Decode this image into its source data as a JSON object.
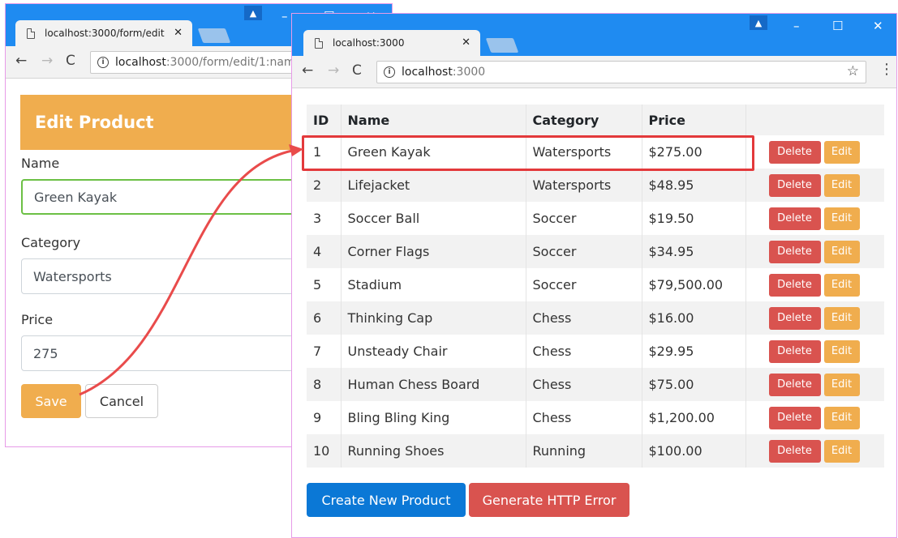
{
  "back_window": {
    "tab_title": "localhost:3000/form/edit",
    "url_host": "localhost",
    "url_path": ":3000/form/edit/1:nam",
    "panel_title": "Edit Product",
    "fields": [
      {
        "label": "Name",
        "value": "Green Kayak"
      },
      {
        "label": "Category",
        "value": "Watersports"
      },
      {
        "label": "Price",
        "value": "275"
      }
    ],
    "save_label": "Save",
    "cancel_label": "Cancel"
  },
  "front_window": {
    "tab_title": "localhost:3000",
    "url_host": "localhost",
    "url_path": ":3000",
    "table": {
      "headers": [
        "ID",
        "Name",
        "Category",
        "Price",
        ""
      ],
      "rows": [
        {
          "id": "1",
          "name": "Green Kayak",
          "category": "Watersports",
          "price": "$275.00"
        },
        {
          "id": "2",
          "name": "Lifejacket",
          "category": "Watersports",
          "price": "$48.95"
        },
        {
          "id": "3",
          "name": "Soccer Ball",
          "category": "Soccer",
          "price": "$19.50"
        },
        {
          "id": "4",
          "name": "Corner Flags",
          "category": "Soccer",
          "price": "$34.95"
        },
        {
          "id": "5",
          "name": "Stadium",
          "category": "Soccer",
          "price": "$79,500.00"
        },
        {
          "id": "6",
          "name": "Thinking Cap",
          "category": "Chess",
          "price": "$16.00"
        },
        {
          "id": "7",
          "name": "Unsteady Chair",
          "category": "Chess",
          "price": "$29.95"
        },
        {
          "id": "8",
          "name": "Human Chess Board",
          "category": "Chess",
          "price": "$75.00"
        },
        {
          "id": "9",
          "name": "Bling Bling King",
          "category": "Chess",
          "price": "$1,200.00"
        },
        {
          "id": "10",
          "name": "Running Shoes",
          "category": "Running",
          "price": "$100.00"
        }
      ],
      "delete_label": "Delete",
      "edit_label": "Edit"
    },
    "create_label": "Create New Product",
    "error_label": "Generate HTTP Error"
  },
  "colors": {
    "titlebar": "#1f8bf1",
    "warning": "#f0ad4e",
    "danger": "#d9534f",
    "primary": "#0b78d6",
    "highlight": "#e3393b",
    "valid": "#6cc045"
  },
  "icons": [
    "page-icon",
    "close-icon",
    "profile-icon",
    "minimize-icon",
    "maximize-icon",
    "back-arrow-icon",
    "forward-arrow-icon",
    "reload-icon",
    "info-icon",
    "star-icon",
    "menu-dots-icon"
  ]
}
